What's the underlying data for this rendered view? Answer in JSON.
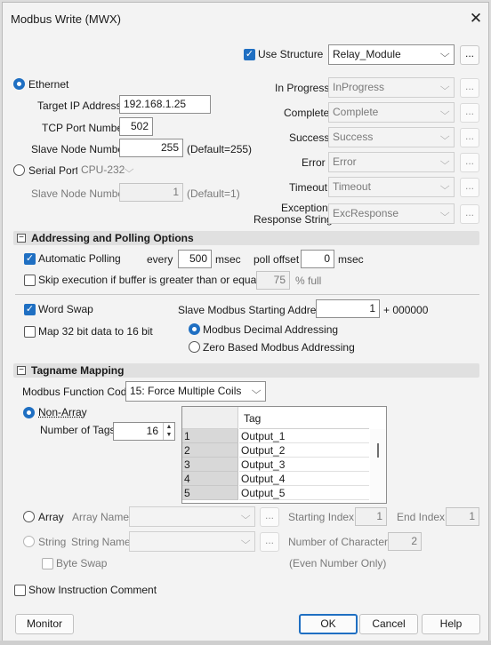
{
  "window": {
    "title": "Modbus Write (MWX)",
    "close_glyph": "✕"
  },
  "structure": {
    "use_structure_label": "Use Structure",
    "use_structure_checked": true,
    "structure_value": "Relay_Module",
    "browse_label": "..."
  },
  "connection": {
    "ethernet_label": "Ethernet",
    "target_ip_label": "Target IP Address",
    "target_ip_value": "192.168.1.25",
    "tcp_port_label": "TCP Port Number",
    "tcp_port_value": "502",
    "slave_node_label": "Slave Node Number",
    "slave_node_value": "255",
    "slave_node_default": "(Default=255)",
    "serial_port_label": "Serial Port",
    "serial_port_value": "CPU-232",
    "serial_slave_node_label": "Slave Node Number",
    "serial_slave_node_value": "1",
    "serial_slave_node_default": "(Default=1)"
  },
  "status_bits": [
    {
      "label": "In Progress",
      "value": "InProgress"
    },
    {
      "label": "Complete",
      "value": "Complete"
    },
    {
      "label": "Success",
      "value": "Success"
    },
    {
      "label": "Error",
      "value": "Error"
    },
    {
      "label": "Timeout",
      "value": "Timeout"
    },
    {
      "label": "Exception",
      "label2": "Response String",
      "value": "ExcResponse"
    }
  ],
  "addressing": {
    "section_title": "Addressing and Polling Options",
    "section_toggle": "−",
    "auto_polling_label": "Automatic Polling",
    "auto_polling_checked": true,
    "every_label": "every",
    "every_value": "500",
    "msec1": "msec",
    "poll_offset_label": "poll offset",
    "poll_offset_value": "0",
    "msec2": "msec",
    "skip_label": "Skip execution if buffer is greater than or equal to",
    "skip_value": "75",
    "skip_unit": "% full",
    "word_swap_label": "Word Swap",
    "word_swap_checked": true,
    "map32_label": "Map 32 bit data to 16 bit",
    "slave_start_label": "Slave Modbus Starting Address",
    "slave_start_value": "1",
    "slave_start_suffix": "+ 000000",
    "decimal_label": "Modbus Decimal Addressing",
    "zero_based_label": "Zero Based Modbus Addressing"
  },
  "tagname": {
    "section_title": "Tagname Mapping",
    "section_toggle": "−",
    "function_code_label": "Modbus Function Code",
    "function_code_value": "15: Force Multiple Coils",
    "non_array_label": "Non-Array",
    "num_tags_label": "Number of Tags",
    "num_tags_value": "16",
    "grid_header": "Tag",
    "rows": [
      {
        "num": "1",
        "tag": "Output_1"
      },
      {
        "num": "2",
        "tag": "Output_2"
      },
      {
        "num": "3",
        "tag": "Output_3"
      },
      {
        "num": "4",
        "tag": "Output_4"
      },
      {
        "num": "5",
        "tag": "Output_5"
      }
    ],
    "array_label": "Array",
    "array_name_label": "Array Name",
    "starting_index_label": "Starting Index",
    "starting_index_value": "1",
    "end_index_label": "End Index",
    "end_index_value": "1",
    "string_label": "String",
    "string_name_label": "String Name",
    "num_chars_label": "Number of Characters",
    "num_chars_value": "2",
    "byte_swap_label": "Byte Swap",
    "even_only_note": "(Even Number Only)"
  },
  "show_comment_label": "Show Instruction Comment",
  "buttons": {
    "monitor": "Monitor",
    "ok": "OK",
    "cancel": "Cancel",
    "help": "Help"
  },
  "colors": {
    "accent": "#1f6fc2",
    "section_bg": "#e0e0e0"
  }
}
